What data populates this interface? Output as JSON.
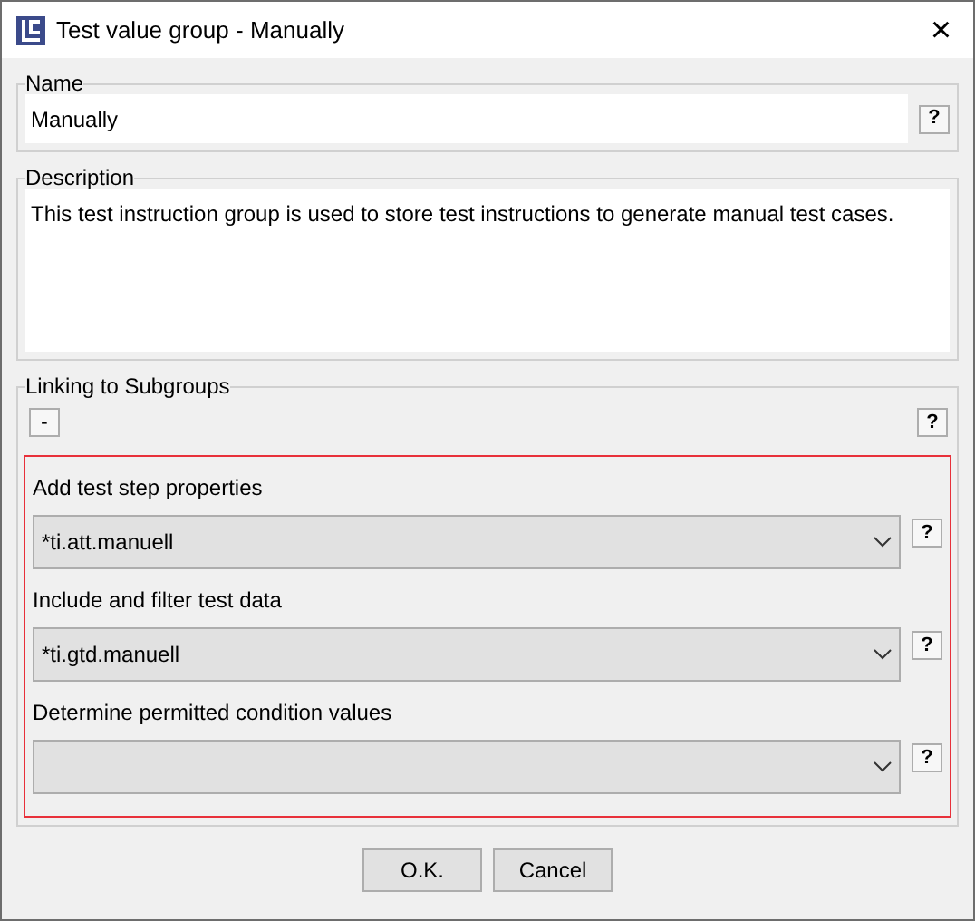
{
  "window": {
    "title": "Test value group - Manually",
    "close": "×"
  },
  "name": {
    "label": "Name",
    "value": "Manually",
    "help": "?"
  },
  "description": {
    "label": "Description",
    "value": "This test instruction group is used to store test instructions to generate manual test cases."
  },
  "linking": {
    "label": "Linking to Subgroups",
    "remove_button": "-",
    "help": "?",
    "fields": [
      {
        "label": "Add test step properties",
        "value": "*ti.att.manuell",
        "help": "?"
      },
      {
        "label": "Include and filter test data",
        "value": "*ti.gtd.manuell",
        "help": "?"
      },
      {
        "label": "Determine permitted condition values",
        "help": "?"
      }
    ]
  },
  "buttons": [
    "O.K.",
    "Cancel"
  ]
}
